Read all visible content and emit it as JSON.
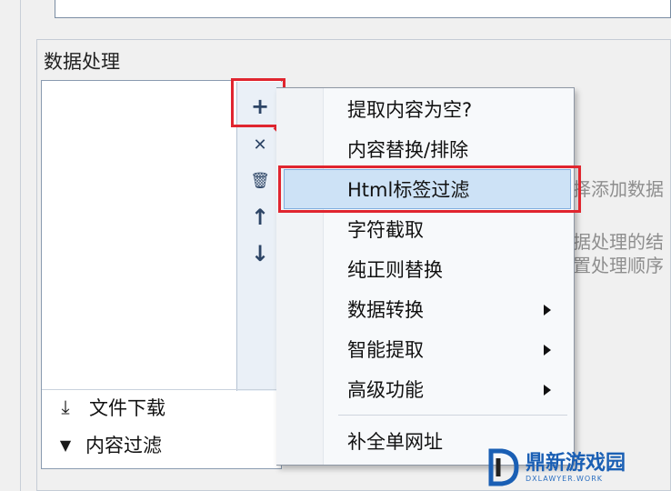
{
  "section": {
    "title": "数据处理"
  },
  "toolbar": {
    "add_glyph": "+",
    "remove_glyph": "✕",
    "delete_glyph": "🗑",
    "up_glyph": "↑",
    "down_glyph": "↓"
  },
  "list_bottom": [
    {
      "icon": "download-icon",
      "icon_glyph": "⤓",
      "label": "文件下载"
    },
    {
      "icon": "filter-icon",
      "icon_glyph": "▼",
      "label": "内容过滤"
    }
  ],
  "hint": {
    "line1": "择添加数据",
    "line2": "据处理的结",
    "line3": "置处理顺序"
  },
  "context_menu": {
    "items": [
      {
        "label": "提取内容为空?",
        "submenu": false
      },
      {
        "label": "内容替换/排除",
        "submenu": false
      },
      {
        "label": "Html标签过滤",
        "submenu": false,
        "highlighted": true
      },
      {
        "label": "字符截取",
        "submenu": false
      },
      {
        "label": "纯正则替换",
        "submenu": false
      },
      {
        "label": "数据转换",
        "submenu": true
      },
      {
        "label": "智能提取",
        "submenu": true
      },
      {
        "label": "高级功能",
        "submenu": true
      },
      {
        "label": "补全单网址",
        "submenu": false
      }
    ]
  },
  "annotation": {
    "color": "#e0252f"
  },
  "watermark": {
    "title": "鼎新游戏园",
    "subtitle": "DXLAWYER.WORK"
  }
}
